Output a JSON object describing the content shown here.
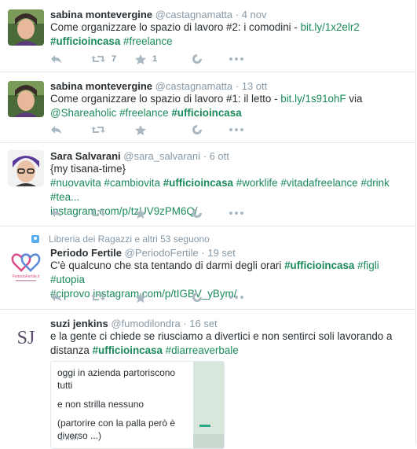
{
  "tweets": [
    {
      "name": "sabina montevergine",
      "handle": "@castagnamatta",
      "time": "4 nov",
      "text_plain": "Come organizzare lo spazio di lavoro #2: i comodini - ",
      "link": "bit.ly/1x2elr2",
      "hashtags": [
        "#ufficioincasa",
        "#freelance"
      ],
      "retweets": "7",
      "favorites": "1"
    },
    {
      "name": "sabina montevergine",
      "handle": "@castagnamatta",
      "time": "13 ott",
      "text_plain": "Come organizzare lo spazio di lavoro #1: il letto - ",
      "link": "bit.ly/1s91ohF",
      "via": " via",
      "mention": "@Shareaholic",
      "hashtags": [
        "#freelance",
        "#ufficioincasa"
      ]
    },
    {
      "name": "Sara Salvarani",
      "handle": "@sara_salvarani",
      "time": "6 ott",
      "text_plain": "{my tisana-time}",
      "hashtags": [
        "#nuovavita",
        "#cambiovita",
        "#ufficioincasa",
        "#worklife",
        "#vitadafreelance",
        "#drink",
        "#tea..."
      ],
      "link": "instagram.com/p/tzUV9zPM6Q/"
    },
    {
      "context": "Libreria dei Ragazzi e altri 53 seguono",
      "name": "Periodo Fertile",
      "handle": "@PeriodoFertile",
      "time": "19 set",
      "text_plain": "C'è qualcuno che sta tentando di darmi degli orari ",
      "hashtags": [
        "#ufficioincasa",
        "#figli",
        "#utopia",
        "#ciprovo"
      ],
      "link": "instagram.com/p/tIGBV_yBym/",
      "avatar_caption": "PeriodoFertile.it"
    },
    {
      "name": "suzi jenkins",
      "handle": "@fumodilondra",
      "time": "16 set",
      "text_plain1": "e la gente ci chiede se riusciamo a divertici e non sentirci soli lavorando a",
      "text_plain2": "distanza ",
      "hashtags": [
        "#ufficioincasa",
        "#diarreaverbale"
      ],
      "avatar_monogram": "SJ",
      "card": {
        "lines": [
          "oggi in azienda partoriscono tutti",
          "e non strilla nessuno",
          "(partorire con la palla però è diverso ...)"
        ],
        "meta": "1 min"
      }
    }
  ],
  "separator": " · ",
  "icons": {
    "reply": "reply-icon",
    "retweet": "retweet-icon",
    "favorite": "star-icon",
    "vine": "vine-icon",
    "more": "more-icon"
  },
  "colors": {
    "link": "#1b8a5a",
    "muted": "#8899a6",
    "icon": "#aab8c2",
    "border": "#e1e8ed"
  }
}
